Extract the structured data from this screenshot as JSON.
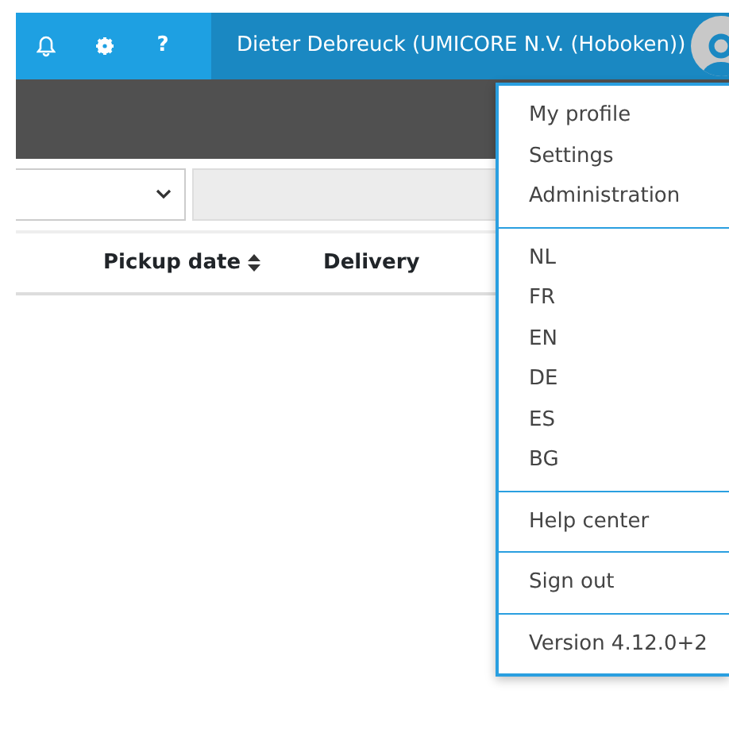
{
  "topbar": {
    "icons": [
      {
        "kind": "bell"
      },
      {
        "kind": "gear"
      },
      {
        "kind": "help",
        "glyph": "?"
      }
    ],
    "user": "Dieter Debreuck (UMICORE N.V. (Hoboken))"
  },
  "filters": {
    "input": {
      "disabled": true
    }
  },
  "table": {
    "columns": [
      {
        "label": "Pickup date",
        "sortable": true
      },
      {
        "label": "Delivery"
      }
    ]
  },
  "menu": {
    "sections": [
      {
        "items": [
          "My profile",
          "Settings",
          "Administration"
        ]
      },
      {
        "items": [
          "NL",
          "FR",
          "EN",
          "DE",
          "ES",
          "BG"
        ]
      },
      {
        "items": [
          "Help center"
        ]
      },
      {
        "items": [
          "Sign out"
        ]
      },
      {
        "items": [
          "Version 4.12.0+2"
        ]
      }
    ]
  }
}
